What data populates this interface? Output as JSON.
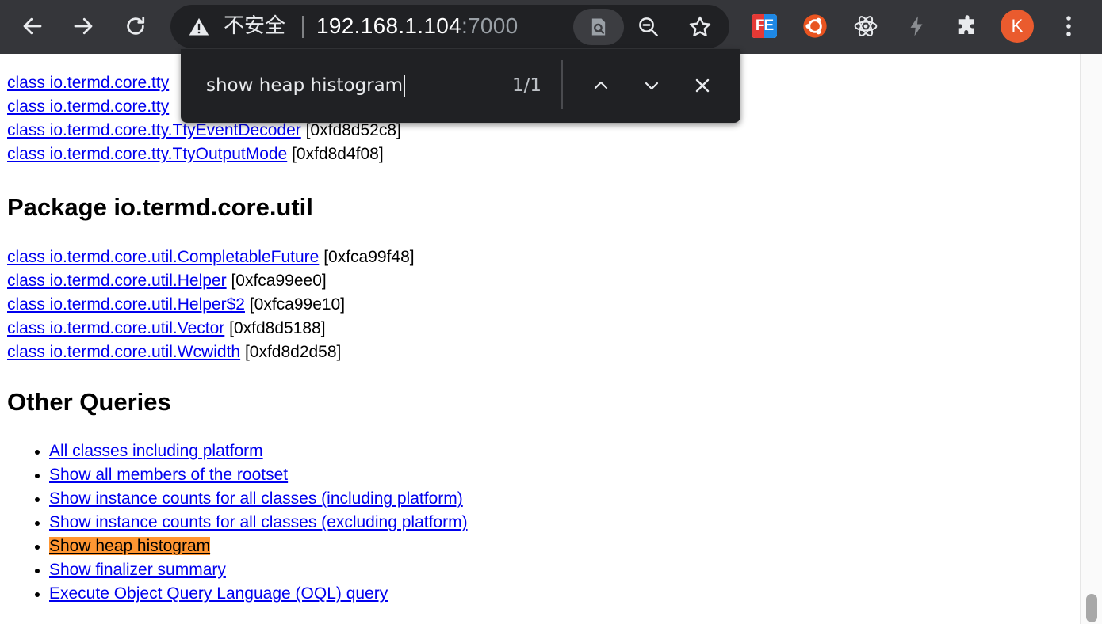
{
  "browser": {
    "security_label": "不安全",
    "url_host": "192.168.1.104",
    "url_port": ":7000",
    "avatar_letter": "K",
    "extension_fe_label": "FE"
  },
  "find_bar": {
    "query": "show heap histogram",
    "match_count": "1/1"
  },
  "page": {
    "top_classes": [
      {
        "text": "class io.termd.core.tty",
        "addr": ""
      },
      {
        "text": "class io.termd.core.tty",
        "addr": ""
      },
      {
        "text": "class io.termd.core.tty.TtyEventDecoder",
        "addr": "[0xfd8d52c8]"
      },
      {
        "text": "class io.termd.core.tty.TtyOutputMode",
        "addr": "[0xfd8d4f08]"
      }
    ],
    "util_heading": "Package io.termd.core.util",
    "util_classes": [
      {
        "text": "class io.termd.core.util.CompletableFuture",
        "addr": "[0xfca99f48]"
      },
      {
        "text": "class io.termd.core.util.Helper",
        "addr": "[0xfca99ee0]"
      },
      {
        "text": "class io.termd.core.util.Helper$2",
        "addr": "[0xfca99e10]"
      },
      {
        "text": "class io.termd.core.util.Vector",
        "addr": "[0xfd8d5188]"
      },
      {
        "text": "class io.termd.core.util.Wcwidth",
        "addr": "[0xfd8d2d58]"
      }
    ],
    "other_heading": "Other Queries",
    "other_queries": [
      "All classes including platform",
      "Show all members of the rootset",
      "Show instance counts for all classes (including platform)",
      "Show instance counts for all classes (excluding platform)",
      "Show heap histogram",
      "Show finalizer summary",
      "Execute Object Query Language (OQL) query"
    ]
  },
  "colors": {
    "toolbar_bg": "#35363a",
    "omnibox_bg": "#202124",
    "link": "#0000ee",
    "find_highlight": "#ff9632",
    "avatar_bg": "#ea5b2e"
  }
}
